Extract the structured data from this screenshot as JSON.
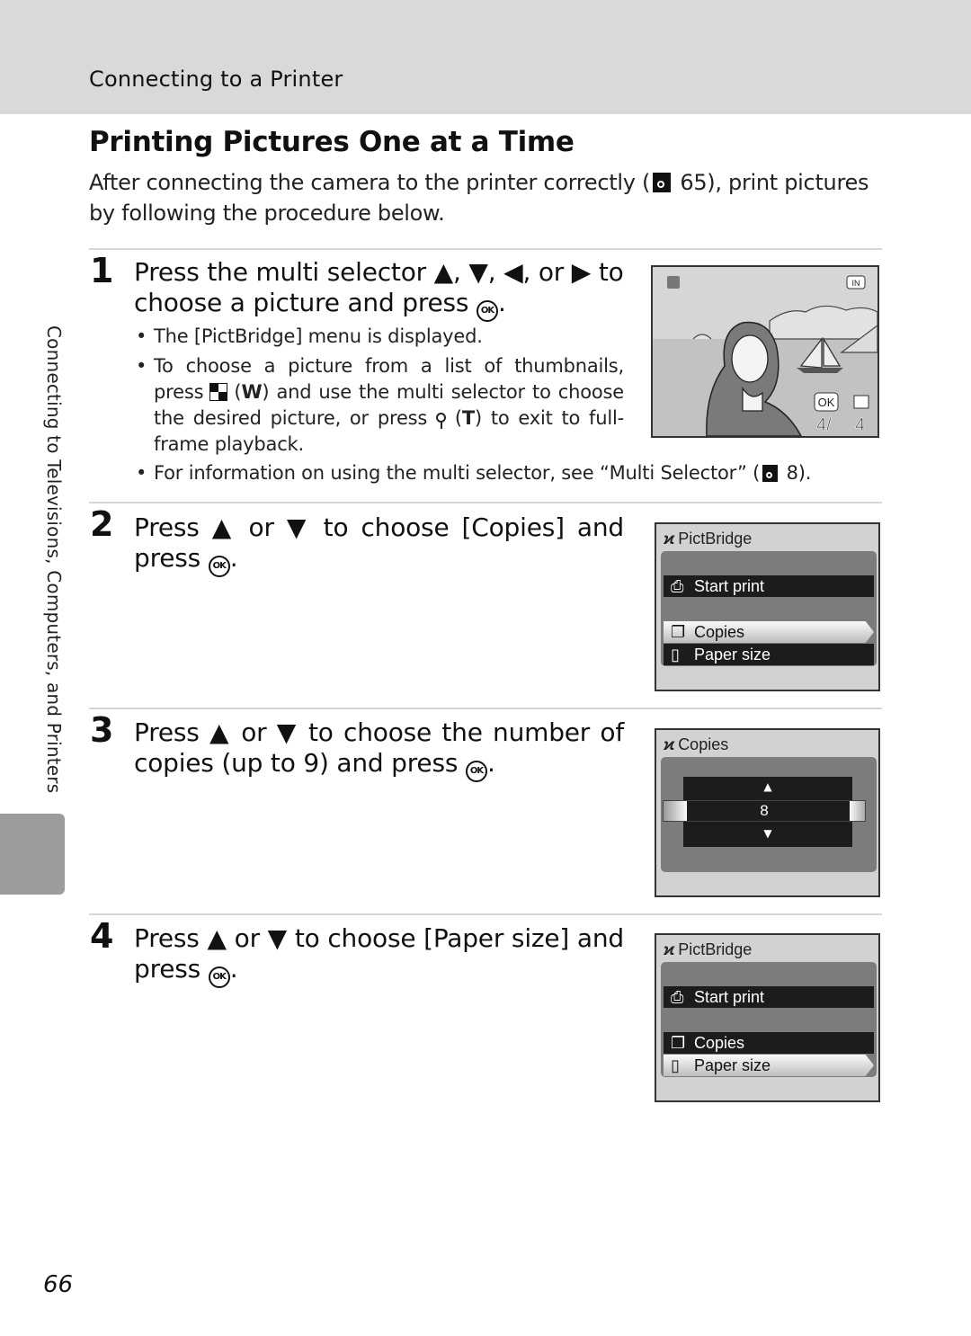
{
  "header": {
    "section": "Connecting to a Printer"
  },
  "title": "Printing Pictures One at a Time",
  "intro": {
    "before": "After connecting the camera to the printer correctly (",
    "ref": " 65), print pictures by following the procedure below."
  },
  "sidebar": {
    "chapter": "Connecting to Televisions, Computers, and Printers"
  },
  "steps": [
    {
      "number": "1",
      "text_a": "Press the multi selector ▲, ▼, ◀, or ▶ to choose a picture and press ",
      "text_b": ".",
      "bullets": [
        "The [PictBridge] menu is displayed.",
        {
          "a": "To choose a picture from a list of thumbnails, press ",
          "b": " (",
          "c": "W",
          "d": ") and use the multi selector to choose the desired picture, or press ",
          "e": " (",
          "f": "T",
          "g": ") to exit to full-frame playback."
        }
      ],
      "note": {
        "a": "For information on using the multi selector, see “Multi Selector” (",
        "b": " 8)."
      },
      "screen": {
        "ok_label": "OK",
        "memory": "IN",
        "frame": "4/",
        "total": "4"
      }
    },
    {
      "number": "2",
      "text_a": "Press ▲ or ▼ to choose [Copies] and press ",
      "text_b": ".",
      "screen": {
        "title": "PictBridge",
        "items": [
          "Start print",
          "Copies",
          "Paper size"
        ],
        "selected": "Copies"
      }
    },
    {
      "number": "3",
      "text_a": "Press ▲ or ▼ to choose the number of copies (up to 9) and press ",
      "text_b": ".",
      "screen": {
        "title": "Copies",
        "value": "8",
        "up": "▲",
        "down": "▼"
      }
    },
    {
      "number": "4",
      "text_a": "Press ▲ or ▼ to choose [Paper size] and press ",
      "text_b": ".",
      "screen": {
        "title": "PictBridge",
        "items": [
          "Start print",
          "Copies",
          "Paper size"
        ],
        "selected": "Paper size"
      }
    }
  ],
  "icons": {
    "ok": "OK",
    "pictbridge": "ϰ",
    "print": "⎙",
    "copies": "❐",
    "paper": "▯"
  },
  "page_number": "66"
}
